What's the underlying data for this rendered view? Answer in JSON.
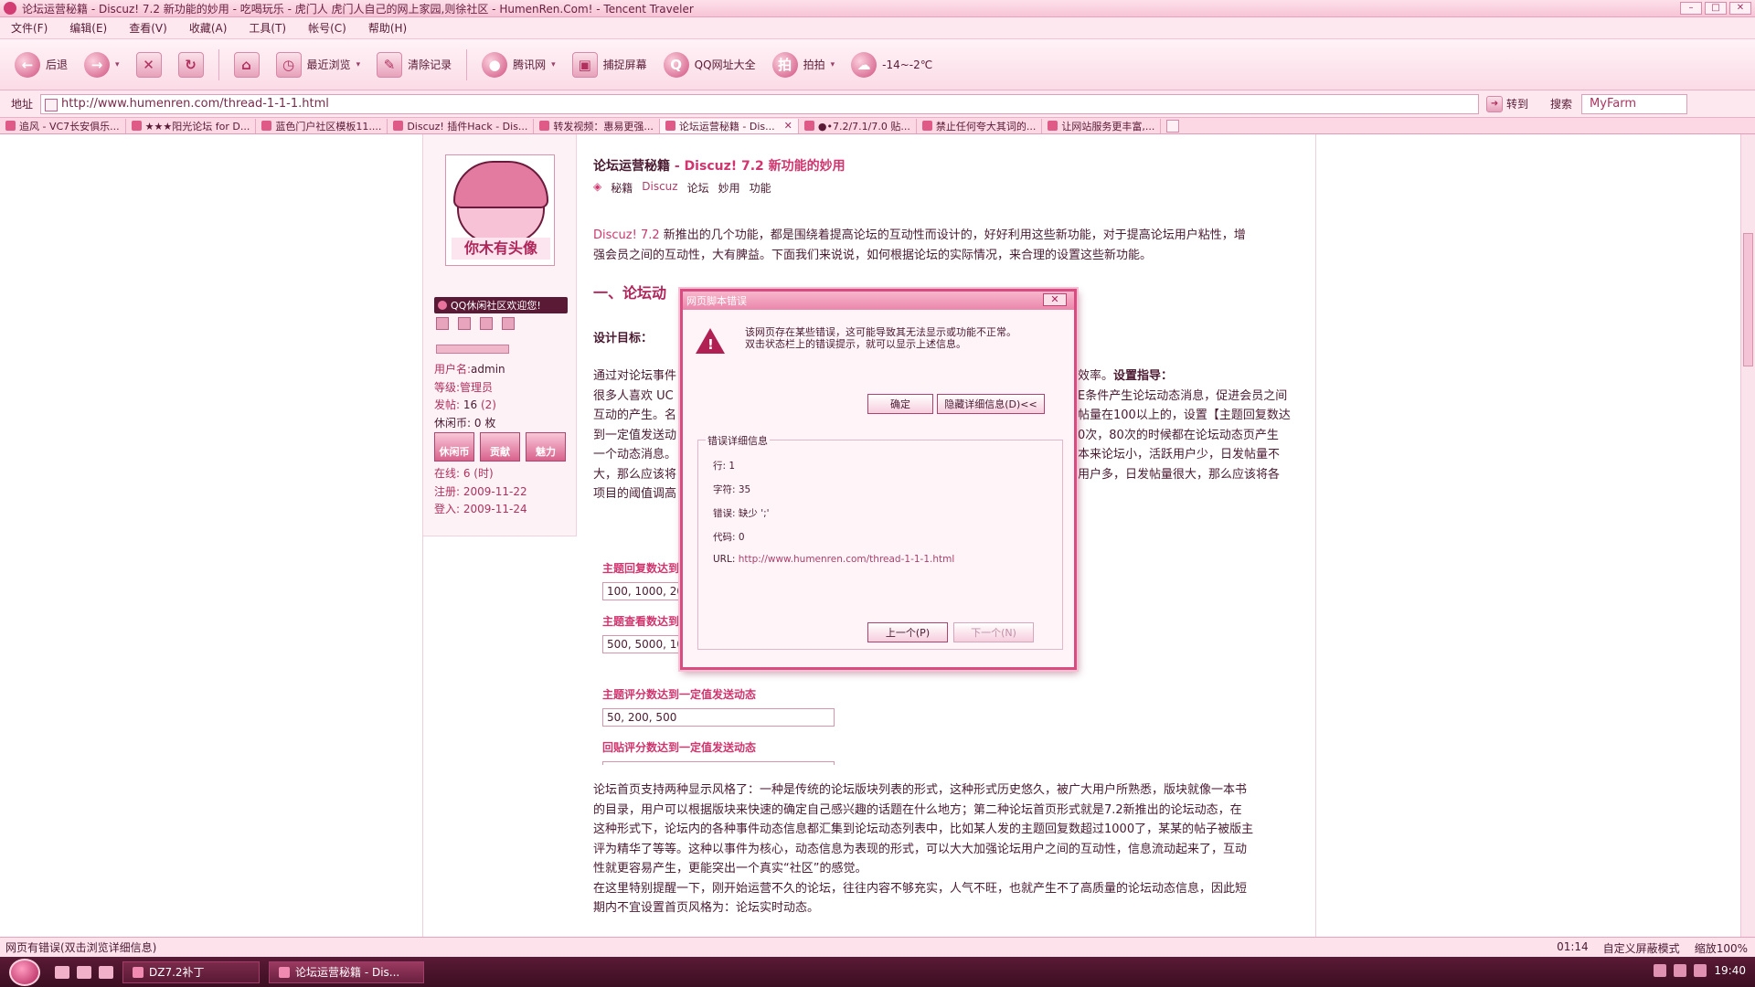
{
  "window": {
    "title": "论坛运营秘籍 - Discuz! 7.2 新功能的妙用 - 吃喝玩乐 - 虎门人 虎门人自己的网上家园,则徐社区 - HumenRen.Com! - Tencent Traveler",
    "controls": [
      "–",
      "□",
      "✕"
    ]
  },
  "menu": [
    "文件(F)",
    "编辑(E)",
    "查看(V)",
    "收藏(A)",
    "工具(T)",
    "帐号(C)",
    "帮助(H)"
  ],
  "toolbar": {
    "back": "后退",
    "recent": "最近浏览",
    "clear": "清除记录",
    "tencent": "腾讯网",
    "capture": "捕捉屏幕",
    "qq_sites": "QQ网址大全",
    "paipai": "拍拍",
    "weather": "-14~-2℃"
  },
  "address": {
    "label": "地址",
    "url": "http://www.humenren.com/thread-1-1-1.html",
    "go": "转到",
    "search_label": "搜索",
    "search_value": "MyFarm"
  },
  "tabs": [
    {
      "label": "追风 - VC7长安俱乐...",
      "active": false
    },
    {
      "label": "★★★阳光论坛 for D...",
      "active": false
    },
    {
      "label": "蓝色门户社区模板11....",
      "active": false
    },
    {
      "label": "Discuz! 插件Hack - Dis...",
      "active": false
    },
    {
      "label": "转发视频：惠易更强...",
      "active": false
    },
    {
      "label": "论坛运营秘籍 - Dis...",
      "active": true
    },
    {
      "label": "●•7.2/7.1/7.0 贴...",
      "active": false
    },
    {
      "label": "禁止任何夸大其词的...",
      "active": false
    },
    {
      "label": "让网站服务更丰富,...",
      "active": false
    }
  ],
  "sidebar": {
    "avatar_caption": "你木有头像",
    "welcome": "QQ休闲社区欢迎您!",
    "username_label": "用户名:",
    "username": "admin",
    "level_label": "等级:",
    "level": "管理员",
    "posts_label": "发帖:",
    "posts": "16",
    "posts_extra": "(2)",
    "coins_label": "休闲币:",
    "coins": "0 枚",
    "badges": [
      "休闲币",
      "贡献",
      "魅力"
    ],
    "online": "在线: 6 (时)",
    "registered": "注册: 2009-11-22",
    "login": "登入: 2009-11-24"
  },
  "post": {
    "title_main": "论坛运营秘籍",
    "title_rest": "- Discuz! 7.2 新功能的妙用",
    "tags": [
      "秘籍",
      "Discuz",
      "论坛",
      "妙用",
      "功能"
    ],
    "intro_hl": "Discuz! 7.2",
    "intro_line1": " 新推出的几个功能，都是围绕着提高论坛的互动性而设计的，好好利用这些新功能，对于提高论坛用户粘性，增",
    "intro_line2": "强会员之间的互动性，大有脾益。下面我们来说说，如何根据论坛的实际情况，来合理的设置这些新功能。",
    "heading1": "一、论坛动",
    "heading2": "设计目标：",
    "p_line1a": "通过对论坛事件",
    "p_line1b": "效率。",
    "p_line1c": "设置指导：",
    "p_line2a": "很多人喜欢 UC",
    "p_line2b": "E条件产生论坛动态消息，促进会员之间",
    "p_line3a": "互动的产生。名",
    "p_line3b": "帖量在100以上的，设置【主题回复数达",
    "p_line4a": "到一定值发送动",
    "p_line4b": "0次，80次的时候都在论坛动态页产生",
    "p_line5a": "一个动态消息。",
    "p_line5b": "本来论坛小，活跃用户少，日发帖量不",
    "p_line6a": "大，那么应该将",
    "p_line6b": "用户多，日发帖量很大，那么应该将各",
    "p_line7a": "项目的阈值调高",
    "form": [
      {
        "label": "主题回复数达到",
        "value": "100, 1000, 20"
      },
      {
        "label": "主题查看数达到",
        "value": "500, 5000, 10"
      },
      {
        "label": "主题评分数达到一定值发送动态",
        "value": "50, 200, 500"
      },
      {
        "label": "回贴评分数达到一定值发送动态",
        "value": ""
      }
    ],
    "bottom_lines": [
      "论坛首页支持两种显示风格了：一种是传统的论坛版块列表的形式，这种形式历史悠久，被广大用户所熟悉，版块就像一本书",
      "的目录，用户可以根据版块来快速的确定自己感兴趣的话题在什么地方；第二种论坛首页形式就是7.2新推出的论坛动态，在",
      "这种形式下，论坛内的各种事件动态信息都汇集到论坛动态列表中，比如某人发的主题回复数超过1000了，某某的帖子被版主",
      "评为精华了等等。这种以事件为核心，动态信息为表现的形式，可以大大加强论坛用户之间的互动性，信息流动起来了，互动",
      "性就更容易产生，更能突出一个真实“社区”的感觉。",
      "在这里特别提醒一下，刚开始运营不久的论坛，往往内容不够充实，人气不旺，也就产生不了高质量的论坛动态信息，因此短",
      "期内不宜设置首页风格为：论坛实时动态。"
    ]
  },
  "dialog": {
    "title": "网页脚本错误",
    "close": "✕",
    "msg_line1": "该网页存在某些错误，这可能导致其无法显示或功能不正常。",
    "msg_line2": "双击状态栏上的错误提示，就可以显示上述信息。",
    "ok": "确定",
    "hide_details": "隐藏详细信息(D)<<",
    "group_label": "错误详细信息",
    "line": "行: 1",
    "char": "字符: 35",
    "error": "错误: 缺少 ';'",
    "code": "代码: 0",
    "url_label": "URL: ",
    "url": "http://www.humenren.com/thread-1-1-1.html",
    "prev": "上一个(P)",
    "next": "下一个(N)"
  },
  "status": {
    "message": "网页有错误(双击浏览详细信息)",
    "time": "01:14",
    "mode": "自定义屏蔽模式",
    "zoom": "缩放100%"
  },
  "taskbar": {
    "items": [
      {
        "label": "DZ7.2补丁",
        "active": false
      },
      {
        "label": "论坛运营秘籍 - Dis...",
        "active": true
      }
    ],
    "clock": "19:40"
  }
}
